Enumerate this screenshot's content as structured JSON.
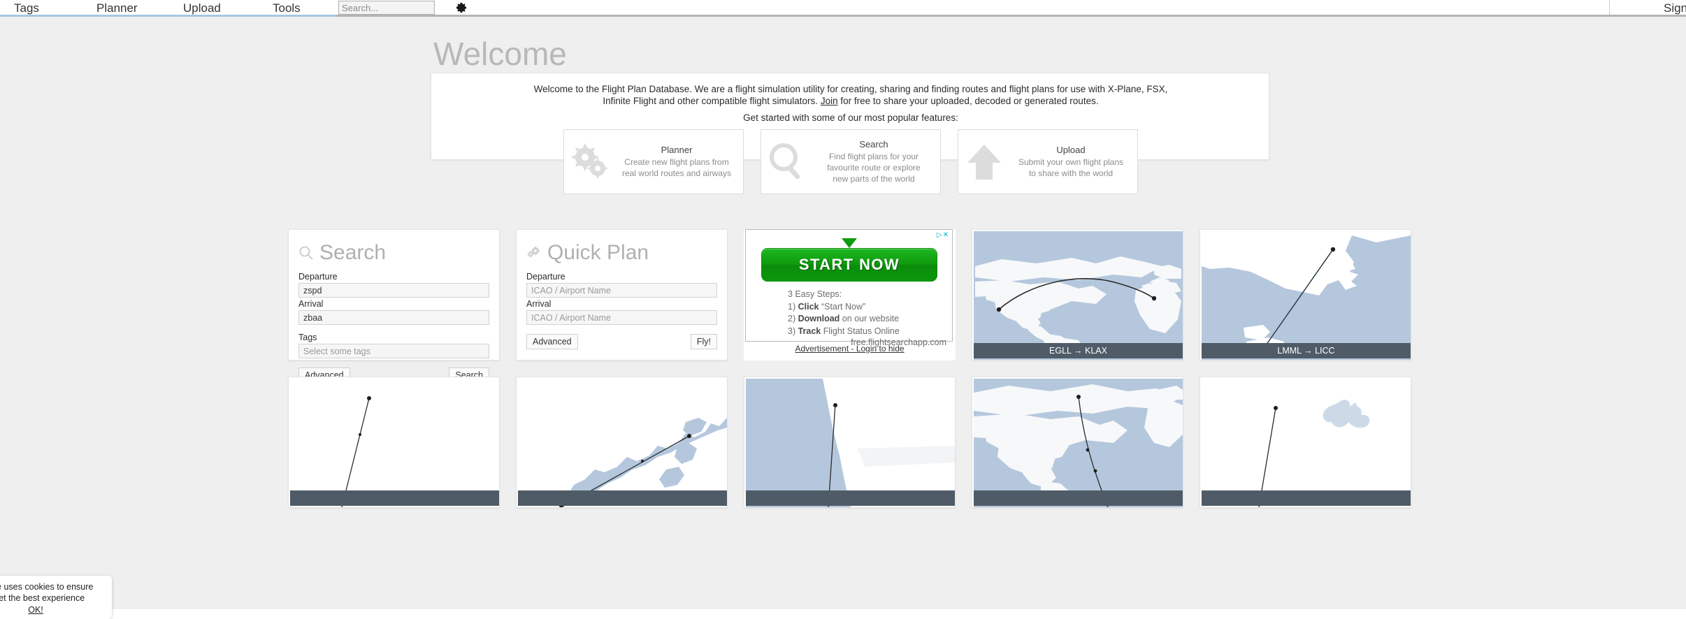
{
  "navbar": {
    "items": [
      {
        "label": "Tags",
        "name": "nav-item-tags"
      },
      {
        "label": "Planner",
        "name": "nav-item-planner"
      },
      {
        "label": "Upload",
        "name": "nav-item-upload"
      },
      {
        "label": "Tools",
        "name": "nav-item-tools"
      }
    ],
    "search_placeholder": "Search...",
    "search_value": "",
    "gear_icon": "gear-icon",
    "sign_label": "Sign",
    "active_underline_color": "#a6c8e0",
    "border_color": "#b4b4b4"
  },
  "welcome": {
    "title": "Welcome",
    "paragraph_line1": "Welcome to the Flight Plan Database. We are a flight simulation utility for creating, sharing and finding routes and flight plans for use with X-Plane, FSX,",
    "paragraph_line2_pre": "Infinite Flight and other compatible flight simulators. ",
    "join_link": "Join",
    "paragraph_line2_post": " for free to share your uploaded, decoded or generated routes.",
    "subtitle": "Get started with some of our most popular features:",
    "features": [
      {
        "title": "Planner",
        "desc_line1": "Create new flight plans from",
        "desc_line2": "real world routes and airways",
        "icon": "gears-icon"
      },
      {
        "title": "Search",
        "desc_line1": "Find flight plans for your",
        "desc_line2": "favourite route or explore",
        "desc_line3": "new parts of the world",
        "icon": "magnifier-icon"
      },
      {
        "title": "Upload",
        "desc_line1": "Submit your own flight plans",
        "desc_line2": "to share with the world",
        "icon": "upload-arrow-icon"
      }
    ]
  },
  "search_card": {
    "title": "Search",
    "icon": "magnifier-icon",
    "departure_label": "Departure",
    "departure_value": "zspd",
    "arrival_label": "Arrival",
    "arrival_value": "zbaa",
    "tags_label": "Tags",
    "tags_placeholder": "Select some tags",
    "tags_value": "",
    "advanced_label": "Advanced",
    "submit_label": "Search"
  },
  "quick_plan_card": {
    "title": "Quick Plan",
    "icon": "gears-icon",
    "departure_label": "Departure",
    "departure_placeholder": "ICAO / Airport Name",
    "departure_value": "",
    "arrival_label": "Arrival",
    "arrival_placeholder": "ICAO / Airport Name",
    "arrival_value": "",
    "advanced_label": "Advanced",
    "submit_label": "Fly!"
  },
  "ad": {
    "adchoices_icon": "adchoices-icon",
    "close_icon": "close-icon",
    "button_label": "START NOW",
    "steps_heading": "3 Easy Steps:",
    "step1_num": "1) ",
    "step1_bold": "Click",
    "step1_rest": " “Start Now”",
    "step2_num": "2) ",
    "step2_bold": "Download",
    "step2_rest": " on our website",
    "step3_num": "3) ",
    "step3_bold": "Track",
    "step3_rest": " Flight Status Online",
    "url": "free.flightsearchapp.com",
    "disclaimer": "Advertisement - Login to hide",
    "button_color": "#0e9a0e"
  },
  "plan_cards": [
    {
      "label": "EGLL → KLAX",
      "map": "world-atlantic"
    },
    {
      "label": "LMML → LICC",
      "map": "mediterranean"
    },
    {
      "label": "",
      "map": "blank-route-1"
    },
    {
      "label": "",
      "map": "coastal-river"
    },
    {
      "label": "",
      "map": "coast-west"
    },
    {
      "label": "",
      "map": "north-atlantic"
    },
    {
      "label": "",
      "map": "blank-route-2"
    }
  ],
  "cookie": {
    "line1": "ebsite uses cookies to ensure",
    "line2": "u get the best experience",
    "ok_label": "OK!"
  },
  "colors": {
    "page_background": "#efefef",
    "card_background": "#ffffff",
    "map_water": "#b4c7dd",
    "map_land": "#ffffff",
    "label_bar": "#4f5b66",
    "heading_gray": "#b0b0b0"
  }
}
